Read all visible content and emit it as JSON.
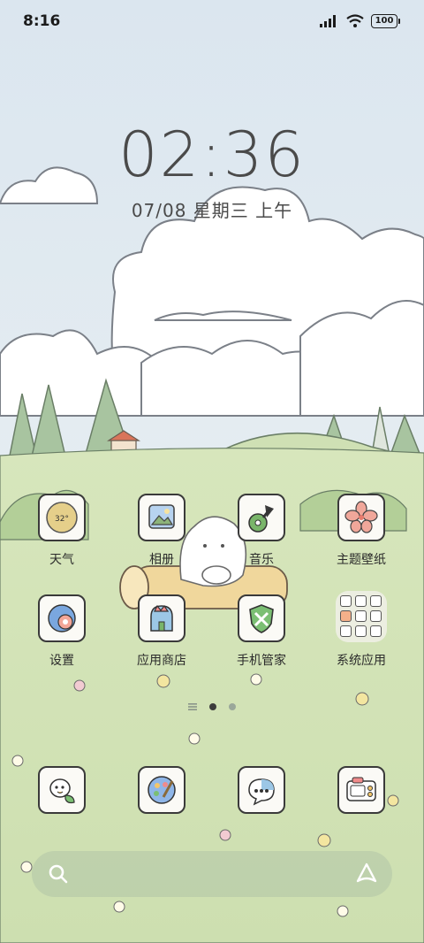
{
  "status_bar": {
    "time": "8:16",
    "battery": "100",
    "icons": [
      "signal-icon",
      "wifi-icon",
      "battery-icon"
    ]
  },
  "lock_widget": {
    "time": "02:36",
    "date": "07/08 星期三 上午"
  },
  "apps_row1": [
    {
      "label": "天气",
      "icon": "weather-icon",
      "badge": "32°"
    },
    {
      "label": "相册",
      "icon": "gallery-icon"
    },
    {
      "label": "音乐",
      "icon": "music-icon"
    },
    {
      "label": "主题壁纸",
      "icon": "theme-icon"
    }
  ],
  "apps_row2": [
    {
      "label": "设置",
      "icon": "settings-icon"
    },
    {
      "label": "应用商店",
      "icon": "app-store-icon"
    },
    {
      "label": "手机管家",
      "icon": "security-icon"
    },
    {
      "label": "系统应用",
      "icon": "folder-icon"
    }
  ],
  "dock": [
    {
      "icon": "phone-icon"
    },
    {
      "icon": "browser-icon"
    },
    {
      "icon": "messages-icon"
    },
    {
      "icon": "camera-icon"
    }
  ],
  "search": {
    "icon": "search-icon",
    "assistant_icon": "assistant-icon"
  },
  "colors": {
    "sky": "#dfe8ee",
    "grass": "#cfe0b2",
    "icon_border": "#3a3a3a",
    "text": "#2b2b2b"
  }
}
